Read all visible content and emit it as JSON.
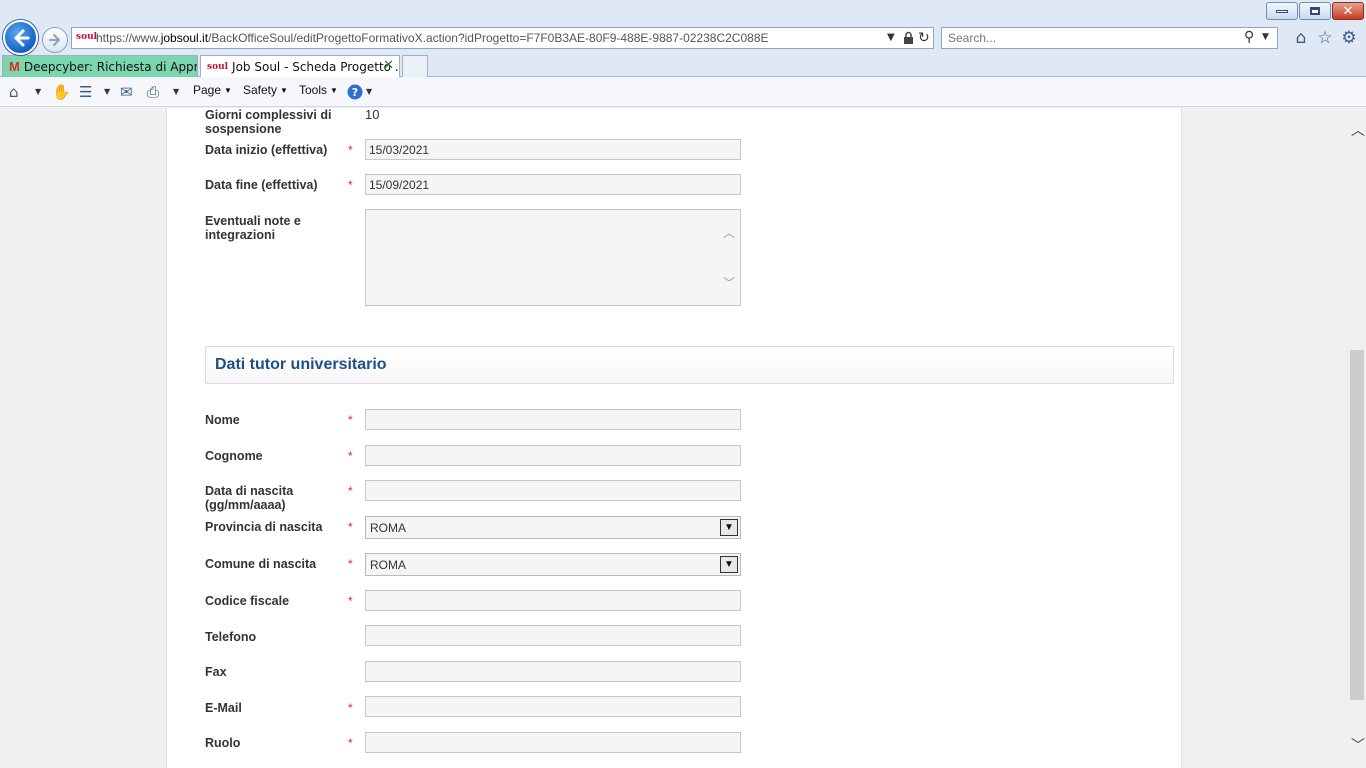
{
  "browser": {
    "url_prefix": "https://www.",
    "url_domain": "jobsoul.it",
    "url_path": "/BackOfficeSoul/editProgettoFormativoX.action?idProgetto=F7F0B3AE-80F9-488E-9887-02238C2C088E",
    "site_icon": "soul",
    "search_placeholder": "Search...",
    "tabs": [
      {
        "label": "Deepcyber: Richiesta di Appro...",
        "icon": "gmail-icon"
      },
      {
        "label": "Job Soul - Scheda Progetto ...",
        "icon": "soul-icon"
      }
    ],
    "gmail_glyph": "M",
    "tab_close": "✕",
    "command_menus": {
      "page": "Page",
      "safety": "Safety",
      "tools": "Tools"
    }
  },
  "form": {
    "sospensione": {
      "label": "Giorni complessivi di sospensione",
      "value": "10"
    },
    "data_inizio": {
      "label": "Data inizio (effettiva)",
      "value": "15/03/2021",
      "required": "*"
    },
    "data_fine": {
      "label": "Data fine (effettiva)",
      "value": "15/09/2021",
      "required": "*"
    },
    "note": {
      "label": "Eventuali note e integrazioni",
      "value": ""
    }
  },
  "tutor_section": {
    "title": "Dati tutor universitario",
    "nome": {
      "label": "Nome",
      "required": "*",
      "value": ""
    },
    "cognome": {
      "label": "Cognome",
      "required": "*",
      "value": ""
    },
    "data_nascita": {
      "label": "Data di nascita (gg/mm/aaaa)",
      "required": "*",
      "value": ""
    },
    "provincia": {
      "label": "Provincia di nascita",
      "required": "*",
      "value": "ROMA"
    },
    "comune": {
      "label": "Comune di nascita",
      "required": "*",
      "value": "ROMA"
    },
    "codice_fiscale": {
      "label": "Codice fiscale",
      "required": "*",
      "value": ""
    },
    "telefono": {
      "label": "Telefono",
      "value": ""
    },
    "fax": {
      "label": "Fax",
      "value": ""
    },
    "email": {
      "label": "E-Mail",
      "required": "*",
      "value": ""
    },
    "ruolo": {
      "label": "Ruolo",
      "required": "*",
      "value": ""
    }
  },
  "colors": {
    "section_title": "#1f4f86",
    "required_marker": "#d62b2b",
    "tab_active_green": "#7bd6ad"
  }
}
